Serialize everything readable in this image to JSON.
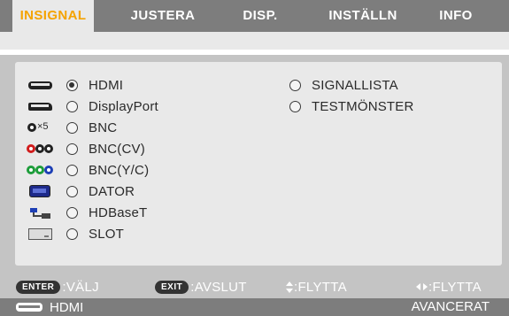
{
  "tabs": [
    {
      "label": "INSIGNAL",
      "active": true
    },
    {
      "label": "JUSTERA",
      "active": false
    },
    {
      "label": "DISP.",
      "active": false
    },
    {
      "label": "INSTÄLLN",
      "active": false
    },
    {
      "label": "INFO",
      "active": false
    }
  ],
  "inputs_left": [
    {
      "label": "HDMI",
      "icon": "hdmi-port-icon",
      "selected": true
    },
    {
      "label": "DisplayPort",
      "icon": "displayport-icon",
      "selected": false
    },
    {
      "label": "BNC",
      "icon": "bnc-x5-icon",
      "icon_text": "×5",
      "selected": false
    },
    {
      "label": "BNC(CV)",
      "icon": "bnc-cv-icon",
      "selected": false
    },
    {
      "label": "BNC(Y/C)",
      "icon": "bnc-yc-icon",
      "selected": false
    },
    {
      "label": "DATOR",
      "icon": "computer-monitor-icon",
      "selected": false
    },
    {
      "label": "HDBaseT",
      "icon": "hdbaset-icon",
      "selected": false
    },
    {
      "label": "SLOT",
      "icon": "slot-icon",
      "selected": false
    }
  ],
  "inputs_right": [
    {
      "label": "SIGNALLISTA",
      "selected": false
    },
    {
      "label": "TESTMÖNSTER",
      "selected": false
    }
  ],
  "help": {
    "enter_key": "ENTER",
    "enter_text": ":VÄLJ",
    "exit_key": "EXIT",
    "exit_text": ":AVSLUT",
    "move_vertical_text": ":FLYTTA",
    "move_horizontal_text": ":FLYTTA"
  },
  "status": {
    "current_input": "HDMI",
    "mode": "AVANCERAT"
  },
  "colors": {
    "active_tab_text": "#f5a300",
    "bnc_cv_dots": [
      "#d11c1c",
      "#222222",
      "#222222"
    ],
    "bnc_yc_dots": [
      "#1d9d3a",
      "#1d9d3a",
      "#1d3fb5"
    ]
  }
}
